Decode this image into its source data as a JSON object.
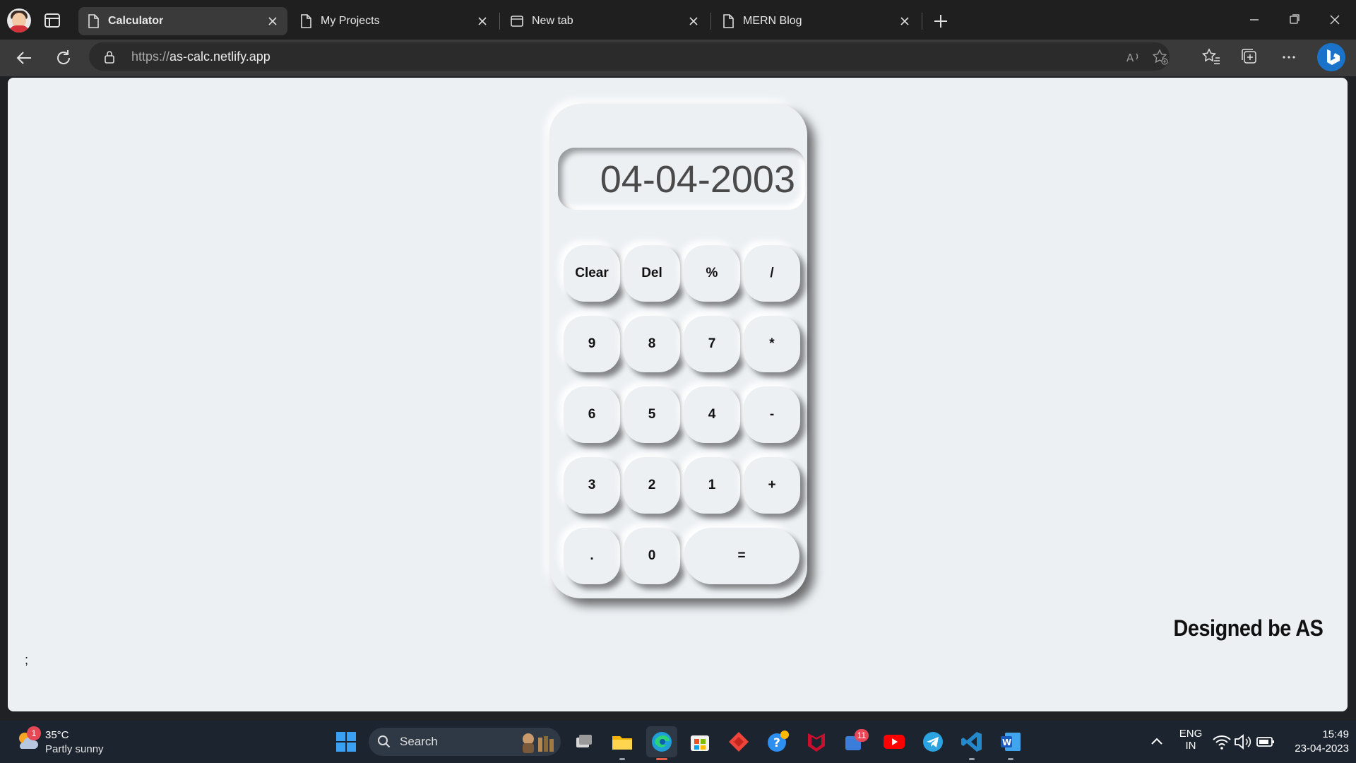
{
  "browser": {
    "tabs": [
      {
        "label": "Calculator",
        "active": true
      },
      {
        "label": "My Projects",
        "active": false
      },
      {
        "label": "New tab",
        "active": false
      },
      {
        "label": "MERN Blog",
        "active": false
      }
    ],
    "url_prefix": "https://",
    "url_host": "as-calc.netlify.app"
  },
  "calculator": {
    "display": "04-04-2003",
    "rows": [
      [
        "Clear",
        "Del",
        "%",
        "/"
      ],
      [
        "9",
        "8",
        "7",
        "*"
      ],
      [
        "6",
        "5",
        "4",
        "-"
      ],
      [
        "3",
        "2",
        "1",
        "+"
      ],
      [
        ".",
        "0",
        "="
      ]
    ]
  },
  "page": {
    "credit": "Designed be AS",
    "stray_text": ";"
  },
  "taskbar": {
    "weather_temp": "35°C",
    "weather_condition": "Partly sunny",
    "weather_badge": "1",
    "search_label": "Search",
    "teams_badge": "11",
    "language": "ENG",
    "region": "IN",
    "time": "15:49",
    "date": "23-04-2023"
  },
  "colors": {
    "page_bg": "#ecf0f3",
    "tabbar_bg": "#1f1f1f",
    "toolbar_bg": "#3a3a3a",
    "taskbar_bg": "#1c2430",
    "accent": "#1a73c8"
  }
}
